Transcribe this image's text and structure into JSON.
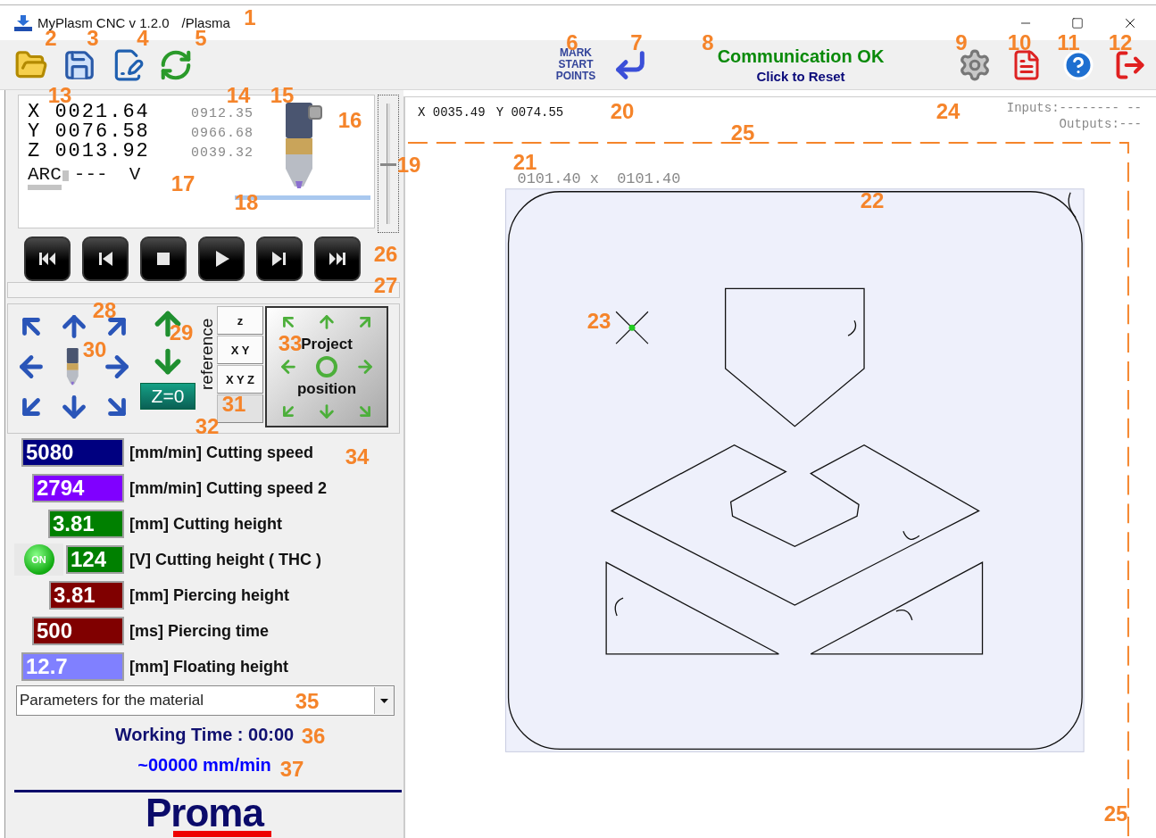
{
  "window": {
    "title": "MyPlasm CNC v 1.2.0",
    "profile": "/Plasma"
  },
  "toolbar": {
    "mark_start_points": "MARK START POINTS",
    "status": "Communication OK",
    "status_action": "Click to Reset"
  },
  "dro": {
    "axes": [
      {
        "axis": "X",
        "value": "0021.64",
        "machine": "0912.35"
      },
      {
        "axis": "Y",
        "value": "0076.58",
        "machine": "0966.68"
      },
      {
        "axis": "Z",
        "value": "0013.92",
        "machine": "0039.32"
      }
    ],
    "arc_label": "ARC",
    "arc_value": "---",
    "arc_unit": "V"
  },
  "z_slider": {
    "level": 0.5
  },
  "progress": {
    "level": 0
  },
  "jog": {
    "z_zero": "Z=0",
    "reference_label": "reference",
    "reference_buttons": [
      {
        "label": "z",
        "disabled": false
      },
      {
        "label": "X Y",
        "disabled": false
      },
      {
        "label": "X Y Z",
        "disabled": false
      },
      {
        "disabled": true
      }
    ],
    "project_position": [
      "Project",
      "position"
    ]
  },
  "parameters": [
    {
      "kind": "value",
      "value": "5080",
      "label": "[mm/min] Cutting speed",
      "color": "#000080"
    },
    {
      "kind": "value",
      "value": "2794",
      "label": "[mm/min] Cutting speed 2",
      "color": "#8000ff"
    },
    {
      "kind": "value",
      "value": "3.81",
      "label": "[mm] Cutting height",
      "color": "#008000"
    },
    {
      "kind": "toggle",
      "on": true,
      "toggle_label": "ON",
      "value": "124",
      "label": "[V] Cutting height ( THC )",
      "color": "#008000"
    },
    {
      "kind": "value",
      "value": "3.81",
      "label": "[mm] Piercing height",
      "color": "#800000"
    },
    {
      "kind": "value",
      "value": "500",
      "label": "[ms] Piercing time",
      "color": "#800000"
    },
    {
      "kind": "value",
      "value": "12.7",
      "label": "[mm] Floating height",
      "color": "#8080ff"
    }
  ],
  "material_select": {
    "value": "Parameters for the material"
  },
  "working_time": "Working Time : 00:00",
  "feed_rate": "~00000 mm/min",
  "logo": "Proma",
  "canvas": {
    "cursor_x": "X 0035.49",
    "cursor_y": "Y 0074.55",
    "inputs": "Inputs:-------- --",
    "outputs": "Outputs:---",
    "dimensions": "0101.40 x  0101.40"
  },
  "callouts": [
    "1",
    "2",
    "3",
    "4",
    "5",
    "6",
    "7",
    "8",
    "9",
    "10",
    "11",
    "12",
    "13",
    "14",
    "15",
    "16",
    "17",
    "18",
    "19",
    "20",
    "21",
    "22",
    "23",
    "24",
    "25",
    "26",
    "27",
    "28",
    "29",
    "30",
    "31",
    "32",
    "33",
    "34",
    "35",
    "36",
    "37",
    "25"
  ]
}
